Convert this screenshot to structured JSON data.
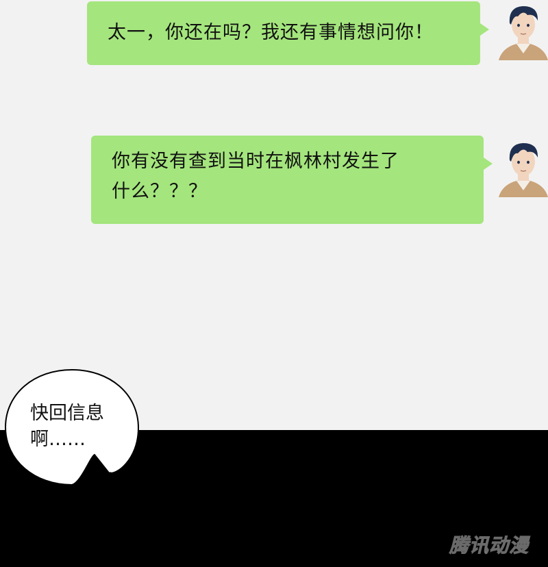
{
  "messages": [
    {
      "text": "太一，你还在吗？我还有事情想问你！"
    },
    {
      "line1": "你有没有查到当时在枫林村发生了",
      "line2": "什么？？？"
    }
  ],
  "speech": {
    "line1": "快回信息",
    "line2": "啊……"
  },
  "watermark": "腾讯动漫",
  "colors": {
    "bubble": "#a4e57d",
    "background": "#f2f2f2",
    "panel": "#000000"
  },
  "icons": [
    "avatar",
    "avatar"
  ]
}
